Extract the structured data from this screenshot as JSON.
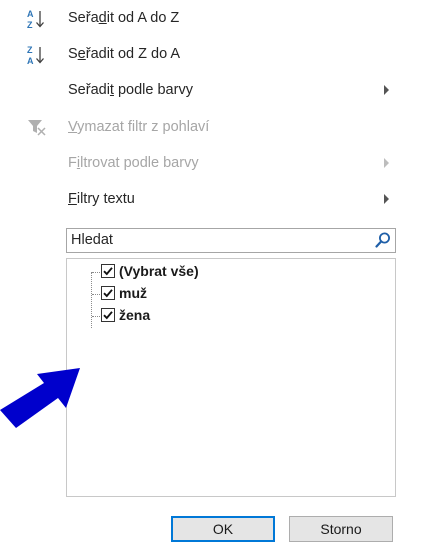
{
  "menu": {
    "sort_az": {
      "pre": "Seřa",
      "u": "d",
      "post": "it od A do Z"
    },
    "sort_za": {
      "pre": "S",
      "u": "e",
      "post": "řadit od Z do A"
    },
    "sort_color": {
      "pre": "Seřadi",
      "u": "t",
      "post": " podle barvy"
    },
    "clear_filter": {
      "pre": "",
      "u": "V",
      "post": "ymazat filtr z pohlaví"
    },
    "filter_color": {
      "pre": "F",
      "u": "i",
      "post": "ltrovat podle barvy"
    },
    "text_filters": {
      "pre": "",
      "u": "F",
      "post": "iltry textu"
    }
  },
  "search": {
    "value": "Hledat"
  },
  "list": {
    "items": [
      {
        "label": "(Vybrat vše)",
        "checked": true
      },
      {
        "label": "muž",
        "checked": true
      },
      {
        "label": "žena",
        "checked": true
      }
    ]
  },
  "buttons": {
    "ok": "OK",
    "cancel": "Storno"
  },
  "colors": {
    "accent": "#0078d7",
    "pointer": "#0000cc",
    "disabled": "#a6a6a6"
  }
}
